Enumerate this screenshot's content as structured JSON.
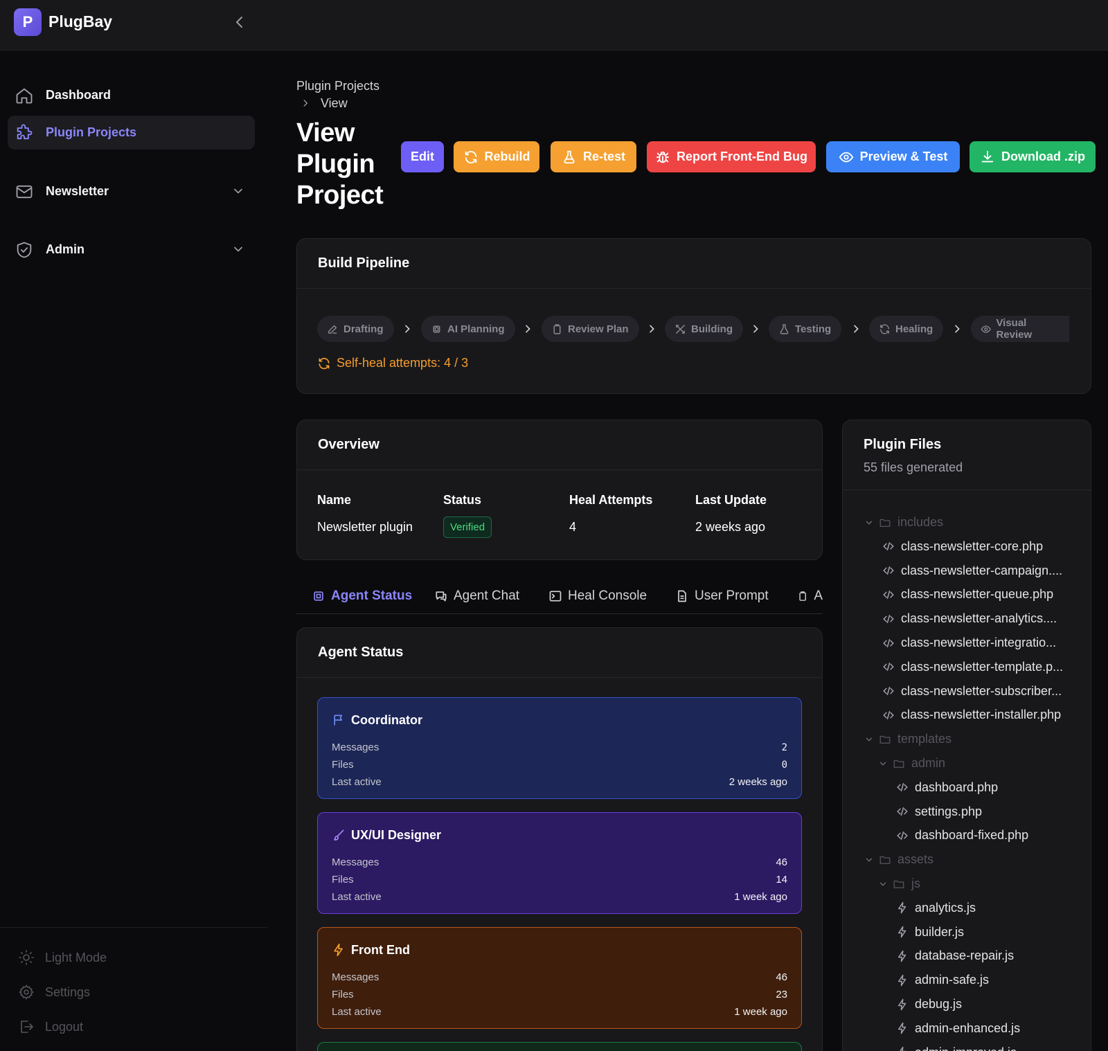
{
  "app": {
    "logo_letter": "P",
    "name": "PlugBay"
  },
  "sidebar": {
    "items": [
      {
        "label": "Dashboard",
        "icon": "home-icon"
      },
      {
        "label": "Plugin Projects",
        "icon": "puzzle-icon",
        "active": true
      },
      {
        "label": "Newsletter",
        "icon": "mail-icon",
        "expandable": true
      },
      {
        "label": "Admin",
        "icon": "shield-check-icon",
        "expandable": true
      }
    ],
    "bottom": {
      "light_mode": "Light Mode",
      "settings": "Settings",
      "logout": "Logout"
    }
  },
  "breadcrumb": {
    "parent": "Plugin Projects",
    "current": "View"
  },
  "page": {
    "title": "View Plugin Project"
  },
  "actions": {
    "edit": "Edit",
    "rebuild": "Rebuild",
    "retest": "Re-test",
    "report_bug": "Report Front-End Bug",
    "preview": "Preview & Test",
    "download": "Download .zip"
  },
  "colors": {
    "edit": "#6d5ef5",
    "rebuild": "#f5a030",
    "retest": "#f5a030",
    "report_bug": "#ef4444",
    "preview": "#3b82f6",
    "download": "#22b565",
    "accent": "#8b86f9",
    "warning": "#f59e2b"
  },
  "pipeline": {
    "title": "Build Pipeline",
    "stages": [
      "Drafting",
      "AI Planning",
      "Review Plan",
      "Building",
      "Testing",
      "Healing",
      "Visual Review"
    ],
    "self_heal": "Self-heal attempts: 4 / 3"
  },
  "overview": {
    "title": "Overview",
    "headers": {
      "name": "Name",
      "status": "Status",
      "heal": "Heal Attempts",
      "update": "Last Update"
    },
    "values": {
      "name": "Newsletter plugin",
      "status": "Verified",
      "heal": "4",
      "update": "2 weeks ago"
    }
  },
  "tabs": [
    "Agent Status",
    "Agent Chat",
    "Heal Console",
    "User Prompt",
    "A"
  ],
  "agent_status": {
    "title": "Agent Status",
    "labels": {
      "messages": "Messages",
      "files": "Files",
      "last_active": "Last active"
    },
    "agents": [
      {
        "name": "Coordinator",
        "icon": "flag-icon",
        "messages": "2",
        "files": "0",
        "last_active": "2 weeks ago"
      },
      {
        "name": "UX/UI Designer",
        "icon": "brush-icon",
        "messages": "46",
        "files": "14",
        "last_active": "1 week ago"
      },
      {
        "name": "Front End",
        "icon": "bolt-icon",
        "messages": "46",
        "files": "23",
        "last_active": "1 week ago"
      }
    ]
  },
  "plugin_files": {
    "title": "Plugin Files",
    "subtitle": "55 files generated",
    "tree": [
      {
        "type": "folder",
        "name": "includes",
        "depth": 0
      },
      {
        "type": "file",
        "name": "class-newsletter-core.php",
        "depth": 1
      },
      {
        "type": "file",
        "name": "class-newsletter-campaign....",
        "depth": 1
      },
      {
        "type": "file",
        "name": "class-newsletter-queue.php",
        "depth": 1
      },
      {
        "type": "file",
        "name": "class-newsletter-analytics....",
        "depth": 1
      },
      {
        "type": "file",
        "name": "class-newsletter-integratio...",
        "depth": 1
      },
      {
        "type": "file",
        "name": "class-newsletter-template.p...",
        "depth": 1
      },
      {
        "type": "file",
        "name": "class-newsletter-subscriber...",
        "depth": 1
      },
      {
        "type": "file",
        "name": "class-newsletter-installer.php",
        "depth": 1
      },
      {
        "type": "folder",
        "name": "templates",
        "depth": 0
      },
      {
        "type": "folder",
        "name": "admin",
        "depth": 1
      },
      {
        "type": "file",
        "name": "dashboard.php",
        "depth": 2
      },
      {
        "type": "file",
        "name": "settings.php",
        "depth": 2
      },
      {
        "type": "file",
        "name": "dashboard-fixed.php",
        "depth": 2
      },
      {
        "type": "folder",
        "name": "assets",
        "depth": 0
      },
      {
        "type": "folder",
        "name": "js",
        "depth": 1
      },
      {
        "type": "jsfile",
        "name": "analytics.js",
        "depth": 2
      },
      {
        "type": "jsfile",
        "name": "builder.js",
        "depth": 2
      },
      {
        "type": "jsfile",
        "name": "database-repair.js",
        "depth": 2
      },
      {
        "type": "jsfile",
        "name": "admin-safe.js",
        "depth": 2
      },
      {
        "type": "jsfile",
        "name": "debug.js",
        "depth": 2
      },
      {
        "type": "jsfile",
        "name": "admin-enhanced.js",
        "depth": 2
      },
      {
        "type": "jsfile",
        "name": "admin-improved.js",
        "depth": 2
      }
    ]
  }
}
